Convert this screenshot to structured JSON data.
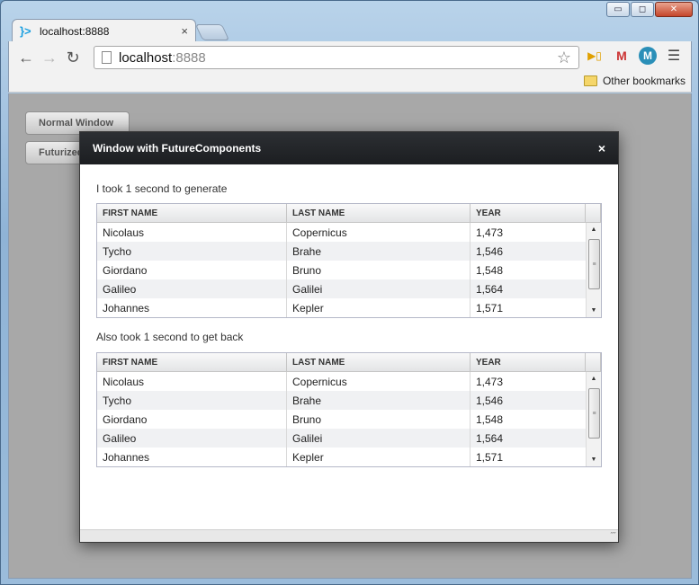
{
  "browser": {
    "tab_title": "localhost:8888",
    "tab_close": "×",
    "url_host": "localhost",
    "url_port": ":8888",
    "bookmarks_folder": "Other bookmarks",
    "window_controls": {
      "minimize": "▭",
      "maximize": "◻",
      "close": "✕"
    },
    "icons": {
      "back": "back-arrow-icon",
      "forward": "forward-arrow-icon",
      "reload": "reload-icon",
      "star": "star-icon"
    }
  },
  "page": {
    "buttons": [
      {
        "label": "Normal Window"
      },
      {
        "label": "Futurized"
      }
    ]
  },
  "modal": {
    "title": "Window with FutureComponents",
    "close_symbol": "×",
    "grids": [
      {
        "caption": "I took 1 second to generate",
        "columns": [
          "FIRST NAME",
          "LAST NAME",
          "YEAR"
        ],
        "rows": [
          [
            "Nicolaus",
            "Copernicus",
            "1,473"
          ],
          [
            "Tycho",
            "Brahe",
            "1,546"
          ],
          [
            "Giordano",
            "Bruno",
            "1,548"
          ],
          [
            "Galileo",
            "Galilei",
            "1,564"
          ],
          [
            "Johannes",
            "Kepler",
            "1,571"
          ]
        ]
      },
      {
        "caption": "Also took 1 second to get back",
        "columns": [
          "FIRST NAME",
          "LAST NAME",
          "YEAR"
        ],
        "rows": [
          [
            "Nicolaus",
            "Copernicus",
            "1,473"
          ],
          [
            "Tycho",
            "Brahe",
            "1,546"
          ],
          [
            "Giordano",
            "Bruno",
            "1,548"
          ],
          [
            "Galileo",
            "Galilei",
            "1,564"
          ],
          [
            "Johannes",
            "Kepler",
            "1,571"
          ]
        ]
      }
    ]
  }
}
